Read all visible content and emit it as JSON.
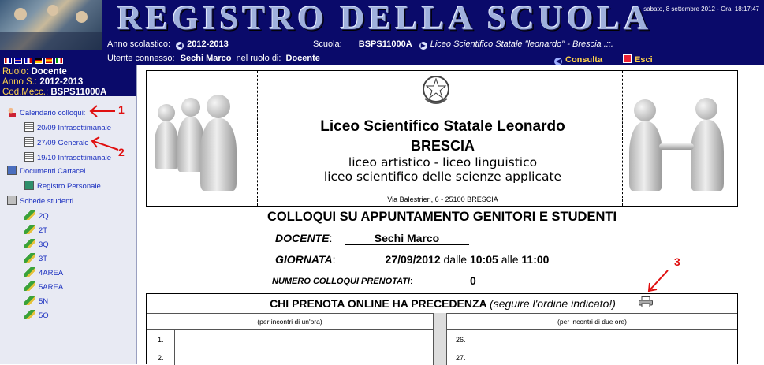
{
  "header": {
    "title": "REGISTRO DELLA SCUOLA",
    "datetime": "sabato, 8 settembre 2012 - Ora: 18:17:47",
    "anno_label": "Anno scolastico:",
    "anno_value": "2012-2013",
    "scuola_label": "Scuola:",
    "scuola_code": "BSPS11000A",
    "scuola_name": "Liceo Scientifico Statale \"leonardo\" - Brescia .::.",
    "utente_label": "Utente connesso:",
    "utente_name": "Sechi Marco",
    "ruolo_label": "nel ruolo di:",
    "ruolo_value": "Docente",
    "consulta_label": "Consulta",
    "esci_label": "Esci"
  },
  "sidebar": {
    "ruolo_label": "Ruolo:",
    "ruolo_value": "Docente",
    "anno_label": "Anno S.:",
    "anno_value": "2012-2013",
    "cod_label": "Cod.Mecc.:",
    "cod_value": "BSPS11000A",
    "calendario": "Calendario colloqui:",
    "calendar_items": [
      "20/09 Infrasettimanale",
      "27/09 Generale",
      "19/10 Infrasettimanale"
    ],
    "documenti": "Documenti Cartacei",
    "registro": "Registro Personale",
    "schede": "Schede studenti",
    "classes": [
      "2Q",
      "2T",
      "3Q",
      "3T",
      "4AREA",
      "5AREA",
      "5N",
      "5O"
    ]
  },
  "annotations": [
    "1",
    "2",
    "3"
  ],
  "school": {
    "name": "Liceo Scientifico Statale Leonardo",
    "city": "BRESCIA",
    "line1": "liceo artistico - liceo linguistico",
    "line2": "liceo scientifico delle scienze applicate",
    "address": "Via Balestrieri, 6 - 25100 BRESCIA"
  },
  "main": {
    "title": "COLLOQUI SU APPUNTAMENTO GENITORI E STUDENTI",
    "docente_label": "DOCENTE",
    "docente_value": "Sechi Marco",
    "giornata_label": "GIORNATA",
    "giornata_date": "27/09/2012",
    "dalle": "dalle",
    "start": "10:05",
    "alle": "alle",
    "end": "11:00",
    "numero_label": "NUMERO COLLOQUI PRENOTATI",
    "numero_value": "0",
    "colon": ":"
  },
  "booking": {
    "title_bold": "CHI PRENOTA ONLINE HA PRECEDENZA",
    "title_italic": "(seguire l'ordine indicato!)",
    "col1_header": "(per incontri di un'ora)",
    "col2_header": "(per incontri di due ore)",
    "left_rows": [
      "1.",
      "2."
    ],
    "right_rows": [
      "26.",
      "27."
    ]
  }
}
